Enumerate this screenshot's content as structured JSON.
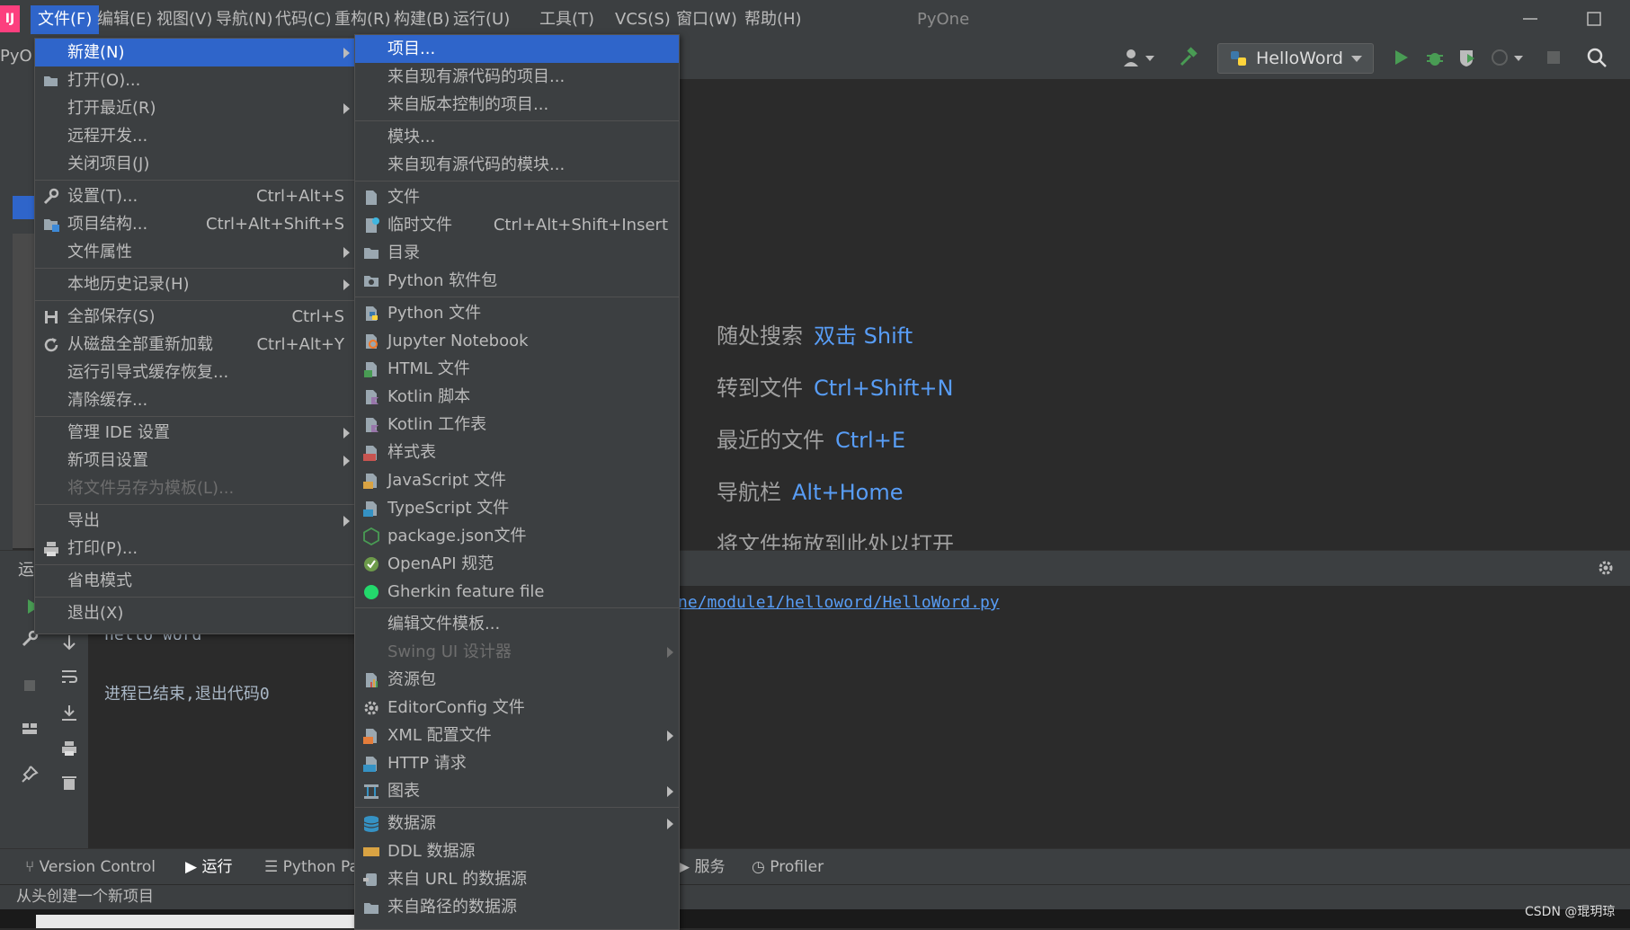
{
  "menubar": {
    "logo": "IJ",
    "items": [
      "文件(F)",
      "编辑(E)",
      "视图(V)",
      "导航(N)",
      "代码(C)",
      "重构(R)",
      "构建(B)",
      "运行(U)",
      "工具(T)",
      "VCS(S)",
      "窗口(W)",
      "帮助(H)"
    ],
    "project_name": "PyOne"
  },
  "toolbar": {
    "run_config": "HelloWord",
    "panel_label": "PyO"
  },
  "file_menu": {
    "items": [
      {
        "label": "新建(N)",
        "shortcut": "",
        "submenu": true,
        "highlighted": true,
        "icon": ""
      },
      {
        "label": "打开(O)...",
        "shortcut": "",
        "submenu": false,
        "icon": "folder-open-icon"
      },
      {
        "label": "打开最近(R)",
        "shortcut": "",
        "submenu": true,
        "icon": ""
      },
      {
        "label": "远程开发...",
        "shortcut": "",
        "submenu": false,
        "icon": ""
      },
      {
        "label": "关闭项目(J)",
        "shortcut": "",
        "submenu": false,
        "icon": ""
      },
      {
        "label": "设置(T)...",
        "shortcut": "Ctrl+Alt+S",
        "submenu": false,
        "icon": "wrench-icon"
      },
      {
        "label": "项目结构...",
        "shortcut": "Ctrl+Alt+Shift+S",
        "submenu": false,
        "icon": "project-structure-icon"
      },
      {
        "label": "文件属性",
        "shortcut": "",
        "submenu": true,
        "icon": ""
      },
      {
        "label": "本地历史记录(H)",
        "shortcut": "",
        "submenu": true,
        "icon": ""
      },
      {
        "label": "全部保存(S)",
        "shortcut": "Ctrl+S",
        "submenu": false,
        "icon": "save-icon"
      },
      {
        "label": "从磁盘全部重新加载",
        "shortcut": "Ctrl+Alt+Y",
        "submenu": false,
        "icon": "reload-icon"
      },
      {
        "label": "运行引导式缓存恢复...",
        "shortcut": "",
        "submenu": false,
        "icon": ""
      },
      {
        "label": "清除缓存...",
        "shortcut": "",
        "submenu": false,
        "icon": ""
      },
      {
        "label": "管理 IDE 设置",
        "shortcut": "",
        "submenu": true,
        "icon": ""
      },
      {
        "label": "新项目设置",
        "shortcut": "",
        "submenu": true,
        "icon": ""
      },
      {
        "label": "将文件另存为模板(L)...",
        "shortcut": "",
        "submenu": false,
        "disabled": true,
        "icon": ""
      },
      {
        "label": "导出",
        "shortcut": "",
        "submenu": true,
        "icon": ""
      },
      {
        "label": "打印(P)...",
        "shortcut": "",
        "submenu": false,
        "icon": "print-icon"
      },
      {
        "label": "省电模式",
        "shortcut": "",
        "submenu": false,
        "icon": ""
      },
      {
        "label": "退出(X)",
        "shortcut": "",
        "submenu": false,
        "icon": ""
      }
    ]
  },
  "new_menu": {
    "items": [
      {
        "label": "项目...",
        "shortcut": "",
        "submenu": false,
        "highlighted": true,
        "icon": ""
      },
      {
        "label": "来自现有源代码的项目...",
        "shortcut": "",
        "submenu": false,
        "icon": ""
      },
      {
        "label": "来自版本控制的项目...",
        "shortcut": "",
        "submenu": false,
        "icon": ""
      },
      {
        "label": "模块...",
        "shortcut": "",
        "submenu": false,
        "icon": ""
      },
      {
        "label": "来自现有源代码的模块...",
        "shortcut": "",
        "submenu": false,
        "icon": ""
      },
      {
        "label": "文件",
        "shortcut": "",
        "submenu": false,
        "icon": "file-icon"
      },
      {
        "label": "临时文件",
        "shortcut": "Ctrl+Alt+Shift+Insert",
        "submenu": false,
        "icon": "scratch-file-icon"
      },
      {
        "label": "目录",
        "shortcut": "",
        "submenu": false,
        "icon": "folder-icon"
      },
      {
        "label": "Python 软件包",
        "shortcut": "",
        "submenu": false,
        "icon": "python-package-icon"
      },
      {
        "label": "Python 文件",
        "shortcut": "",
        "submenu": false,
        "icon": "python-file-icon"
      },
      {
        "label": "Jupyter Notebook",
        "shortcut": "",
        "submenu": false,
        "icon": "jupyter-icon"
      },
      {
        "label": "HTML 文件",
        "shortcut": "",
        "submenu": false,
        "icon": "html-file-icon"
      },
      {
        "label": "Kotlin 脚本",
        "shortcut": "",
        "submenu": false,
        "icon": "kotlin-script-icon"
      },
      {
        "label": "Kotlin 工作表",
        "shortcut": "",
        "submenu": false,
        "icon": "kotlin-worksheet-icon"
      },
      {
        "label": "样式表",
        "shortcut": "",
        "submenu": false,
        "icon": "css-file-icon"
      },
      {
        "label": "JavaScript 文件",
        "shortcut": "",
        "submenu": false,
        "icon": "javascript-file-icon"
      },
      {
        "label": "TypeScript 文件",
        "shortcut": "",
        "submenu": false,
        "icon": "typescript-file-icon"
      },
      {
        "label": "package.json文件",
        "shortcut": "",
        "submenu": false,
        "icon": "nodejs-icon"
      },
      {
        "label": "OpenAPI 规范",
        "shortcut": "",
        "submenu": false,
        "icon": "openapi-icon"
      },
      {
        "label": "Gherkin feature file",
        "shortcut": "",
        "submenu": false,
        "icon": "gherkin-icon"
      },
      {
        "label": "编辑文件模板...",
        "shortcut": "",
        "submenu": false,
        "icon": ""
      },
      {
        "label": "Swing UI 设计器",
        "shortcut": "",
        "submenu": true,
        "disabled": true,
        "icon": ""
      },
      {
        "label": "资源包",
        "shortcut": "",
        "submenu": false,
        "icon": "resource-bundle-icon"
      },
      {
        "label": "EditorConfig 文件",
        "shortcut": "",
        "submenu": false,
        "icon": "gear-icon"
      },
      {
        "label": "XML 配置文件",
        "shortcut": "",
        "submenu": true,
        "icon": "xml-file-icon"
      },
      {
        "label": "HTTP 请求",
        "shortcut": "",
        "submenu": false,
        "icon": "api-icon"
      },
      {
        "label": "图表",
        "shortcut": "",
        "submenu": true,
        "icon": "diagram-icon"
      },
      {
        "label": "数据源",
        "shortcut": "",
        "submenu": true,
        "icon": "database-icon"
      },
      {
        "label": "DDL 数据源",
        "shortcut": "",
        "submenu": false,
        "icon": "ddl-icon"
      },
      {
        "label": "来自 URL 的数据源",
        "shortcut": "",
        "submenu": false,
        "icon": "url-datasource-icon"
      },
      {
        "label": "来自路径的数据源",
        "shortcut": "",
        "submenu": false,
        "icon": "path-datasource-icon"
      }
    ]
  },
  "editor": {
    "hints": [
      {
        "label": "随处搜索",
        "key": "双击 Shift"
      },
      {
        "label": "转到文件",
        "key": "Ctrl+Shift+N"
      },
      {
        "label": "最近的文件",
        "key": "Ctrl+E"
      },
      {
        "label": "导航栏",
        "key": "Alt+Home"
      },
      {
        "label": "将文件拖放到此处以打开",
        "key": ""
      }
    ]
  },
  "run_panel": {
    "label": "运",
    "path_link": "ne/module1/helloword/HelloWord.py",
    "output_line": "hello word",
    "exit_message": "进程已结束,退出代码0"
  },
  "bottom_tabs": [
    "Version Control",
    "运行",
    "Python Pa",
    "服务",
    "Profiler"
  ],
  "status_bar": {
    "text": "从头创建一个新项目"
  },
  "watermark": "CSDN @琨玥琼",
  "colors": {
    "accent": "#2f65ca",
    "link": "#589df6",
    "run_green": "#499c54",
    "bg": "#2b2b2b",
    "panel": "#3c3f41"
  }
}
